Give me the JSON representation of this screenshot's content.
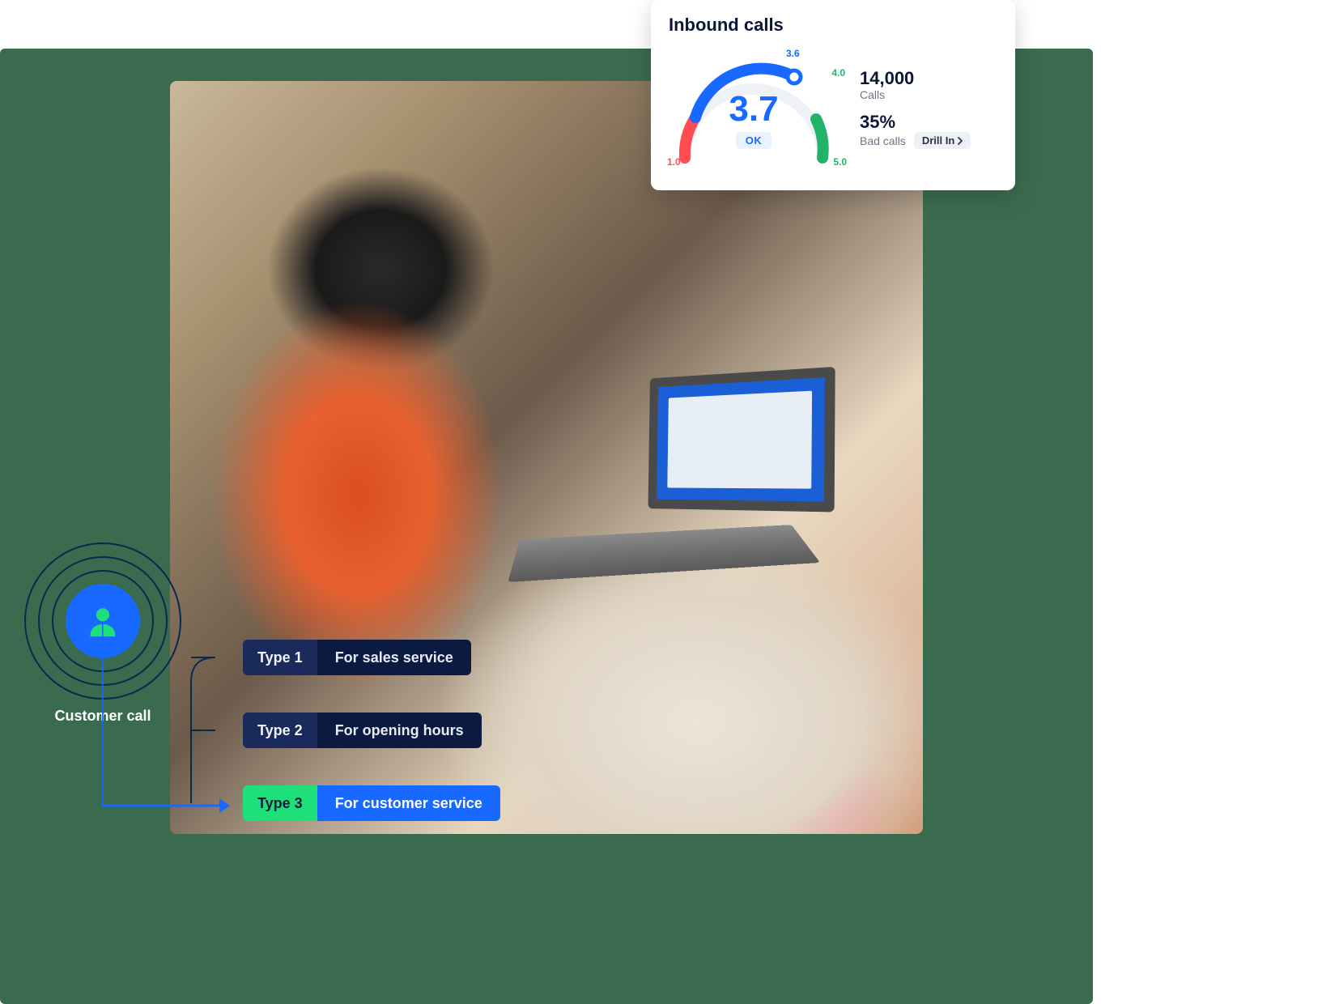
{
  "card": {
    "title": "Inbound calls",
    "gauge": {
      "value": "3.7",
      "status": "OK",
      "ticks": {
        "min": "1.0",
        "mark": "3.6",
        "upper": "4.0",
        "max": "5.0"
      }
    },
    "stats": {
      "calls_value": "14,000",
      "calls_label": "Calls",
      "bad_value": "35%",
      "bad_label": "Bad calls"
    },
    "drill_label": "Drill In"
  },
  "badge": {
    "label": "Customer call"
  },
  "chips": [
    {
      "tag": "Type 1",
      "desc": "For sales service"
    },
    {
      "tag": "Type 2",
      "desc": "For opening hours"
    },
    {
      "tag": "Type 3",
      "desc": "For customer service"
    }
  ],
  "chart_data": {
    "type": "gauge",
    "title": "Inbound calls",
    "value": 3.7,
    "min": 1.0,
    "max": 5.0,
    "mark": 3.6,
    "segments": [
      {
        "from": 1.0,
        "to": 2.0,
        "color": "#ff4d52",
        "name": "bad"
      },
      {
        "from": 2.0,
        "to": 4.0,
        "color": "#1769ff",
        "name": "ok"
      },
      {
        "from": 4.0,
        "to": 5.0,
        "color": "#22b36b",
        "name": "good"
      }
    ],
    "status": "OK",
    "side_stats": [
      {
        "value": 14000,
        "label": "Calls"
      },
      {
        "value_pct": 35,
        "label": "Bad calls"
      }
    ]
  }
}
